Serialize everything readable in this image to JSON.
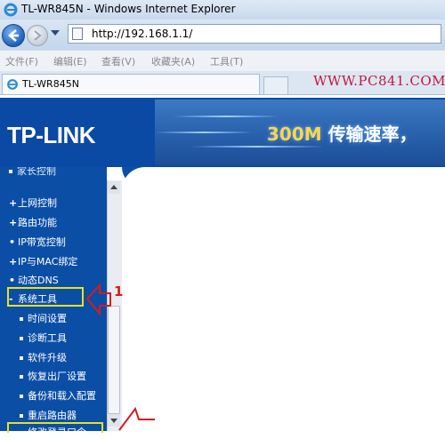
{
  "window": {
    "title": "TL-WR845N - Windows Internet Explorer",
    "url": "http://192.168.1.1/",
    "tab_title": "TL-WR845N"
  },
  "menu": [
    "文件(F)",
    "编辑(E)",
    "查看(V)",
    "收藏夹(A)",
    "工具(T)"
  ],
  "watermark": "WWW.PC841.COM",
  "banner": {
    "logo": "TP-LINK",
    "slogan_number": "300M",
    "slogan_text": "传输速率，"
  },
  "nav": {
    "partial_top": "家长控制",
    "items": [
      {
        "label": "上网控制",
        "marker": "+"
      },
      {
        "label": "路由功能",
        "marker": "+"
      },
      {
        "label": "IP带宽控制",
        "marker": "•"
      },
      {
        "label": "IP与MAC绑定",
        "marker": "+"
      },
      {
        "label": "动态DNS",
        "marker": "•"
      },
      {
        "label": "系统工具",
        "marker": "-"
      }
    ],
    "sub_items": [
      "时间设置",
      "诊断工具",
      "软件升级",
      "恢复出厂设置",
      "备份和载入配置",
      "重启路由器",
      "修改登录口令"
    ]
  },
  "annotation": {
    "number": "1"
  },
  "colors": {
    "nav_bg": "#0b4ea6",
    "highlight": "#e7e21f",
    "annotation": "#d41c1c"
  }
}
